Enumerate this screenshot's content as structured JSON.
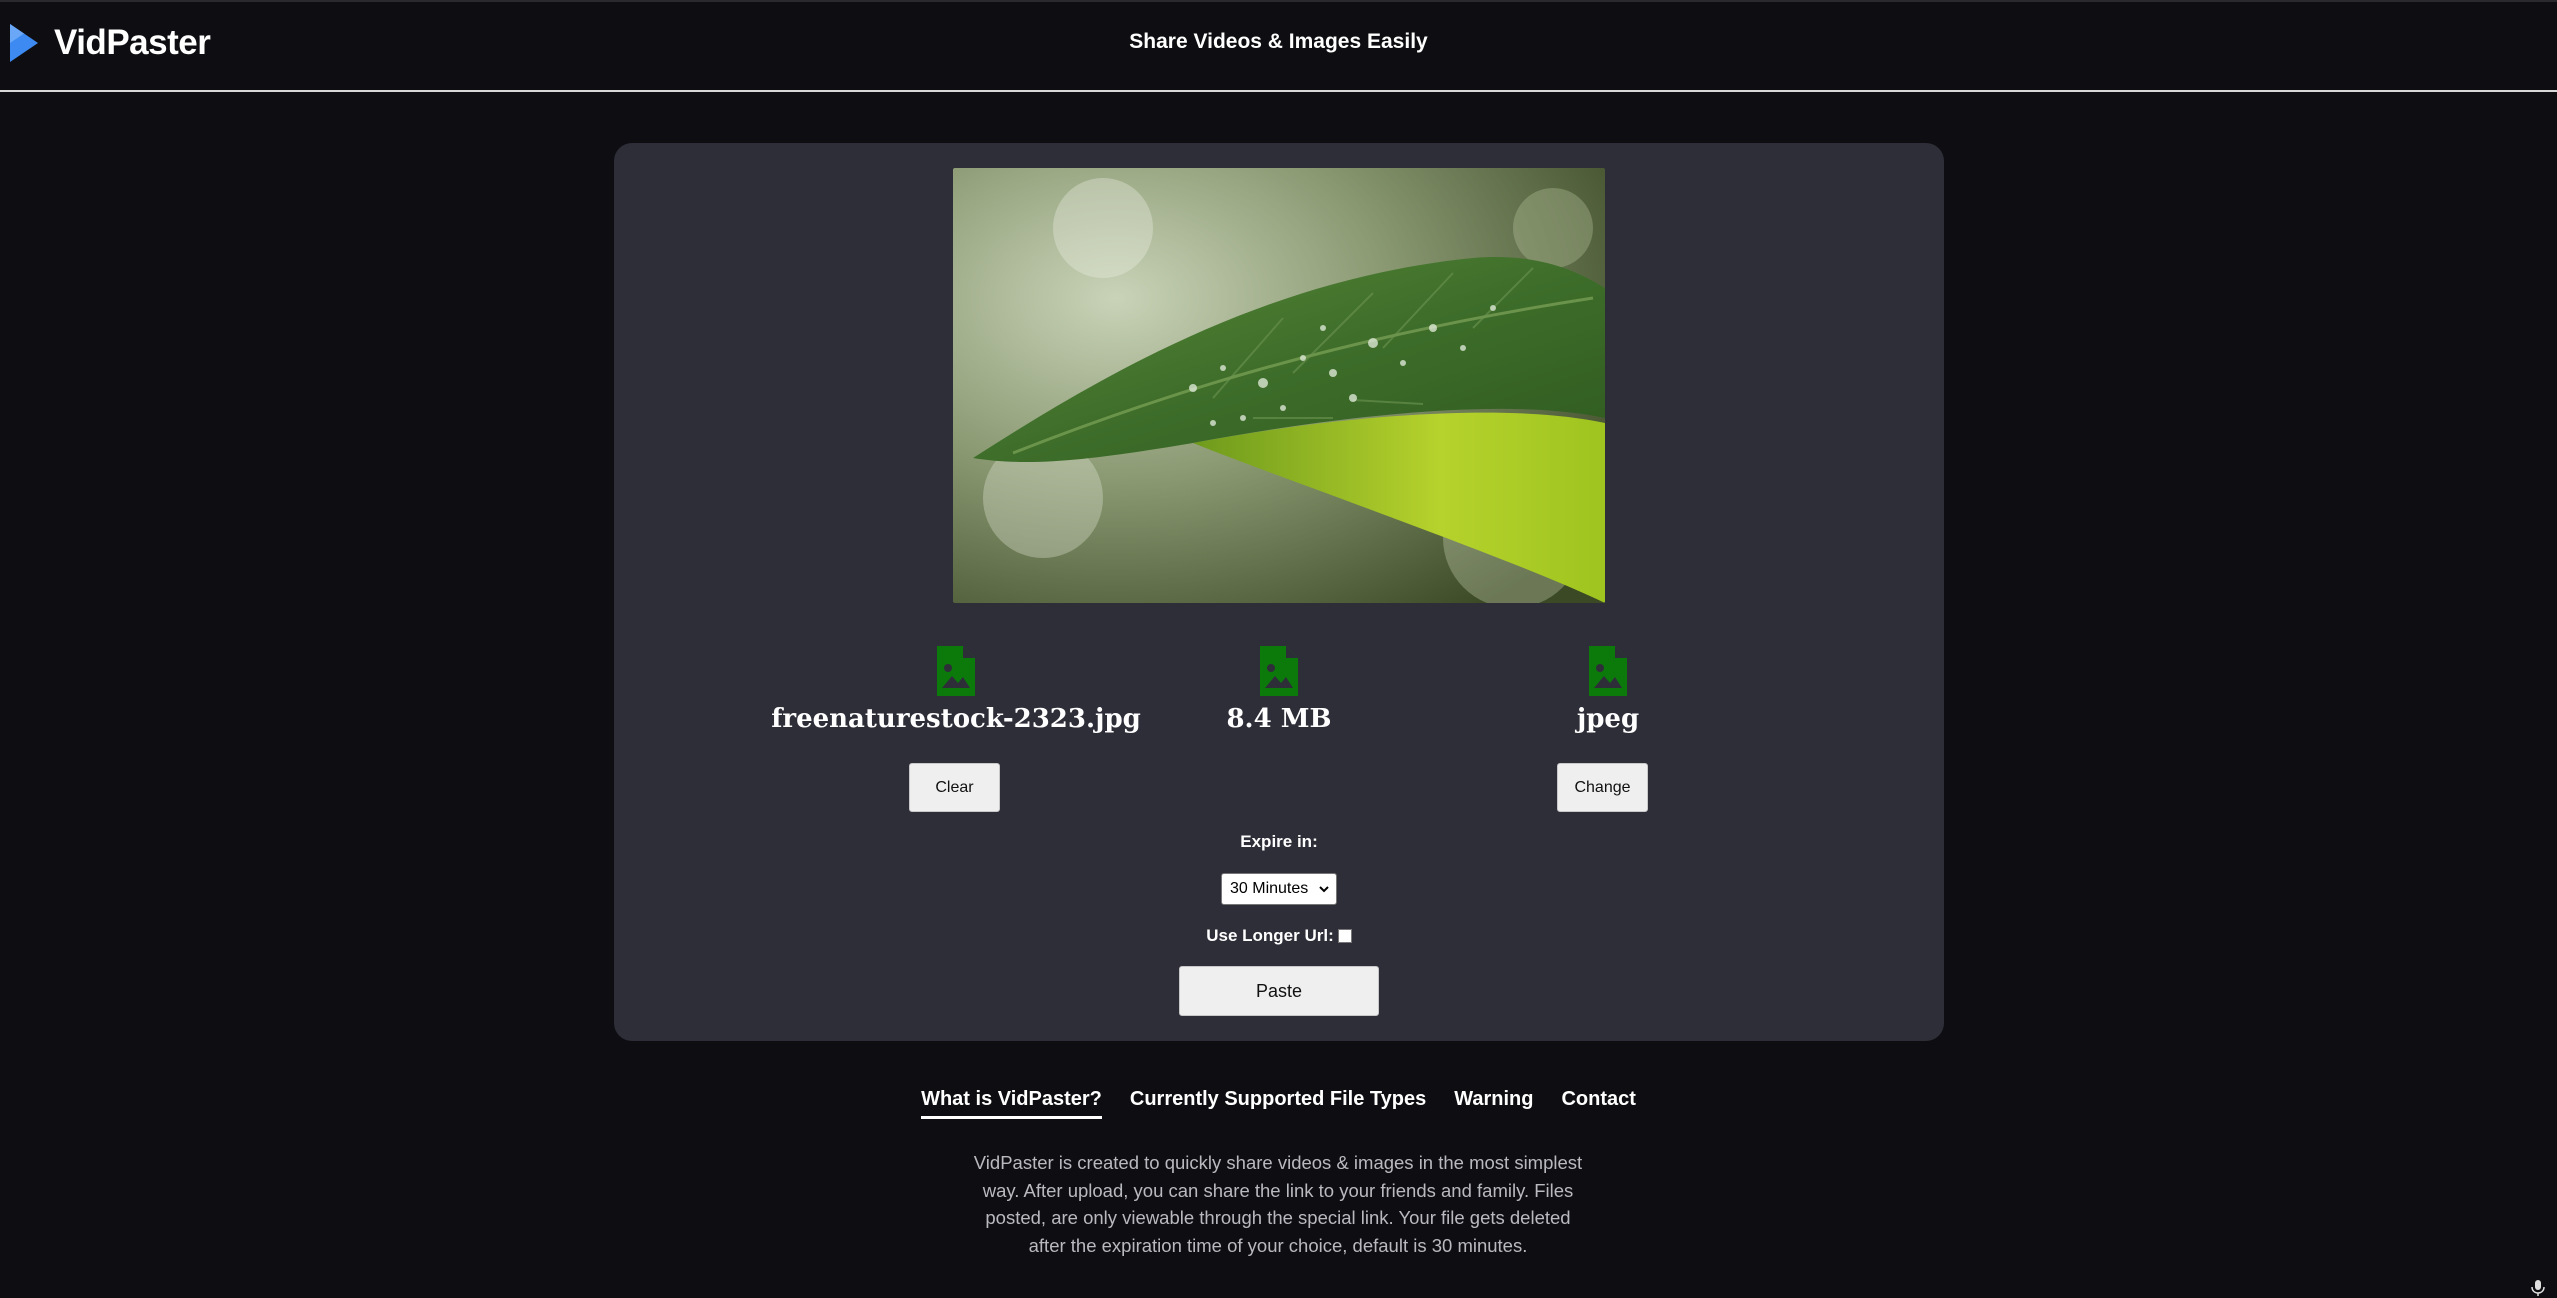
{
  "header": {
    "app_name": "VidPaster",
    "tagline": "Share Videos & Images Easily",
    "logo_icon": "play-triangle-icon",
    "accent_color": "#3d8bf2"
  },
  "upload": {
    "preview_alt": "Uploaded image preview: green leaf with water droplets",
    "file_name": "freenaturestock-2323.jpg",
    "file_size": "8.4 MB",
    "file_type": "jpeg",
    "file_icon": "file-image-icon",
    "file_icon_color": "#0b7a0b",
    "clear_label": "Clear",
    "change_label": "Change",
    "expire_label": "Expire in:",
    "expire_value": "30 Minutes",
    "longer_url_label": "Use Longer Url:",
    "longer_url_checked": false,
    "paste_label": "Paste"
  },
  "info_nav": {
    "tabs": [
      {
        "label": "What is VidPaster?",
        "active": true
      },
      {
        "label": "Currently Supported File Types",
        "active": false
      },
      {
        "label": "Warning",
        "active": false
      },
      {
        "label": "Contact",
        "active": false
      }
    ],
    "description": "VidPaster is created to quickly share videos & images in the most simplest way. After upload, you can share the link to your friends and family. Files posted, are only viewable through the special link. Your file gets deleted after the expiration time of your choice, default is 30 minutes."
  },
  "colors": {
    "page_bg": "#0e0e12",
    "card_bg": "#2e2e39"
  }
}
